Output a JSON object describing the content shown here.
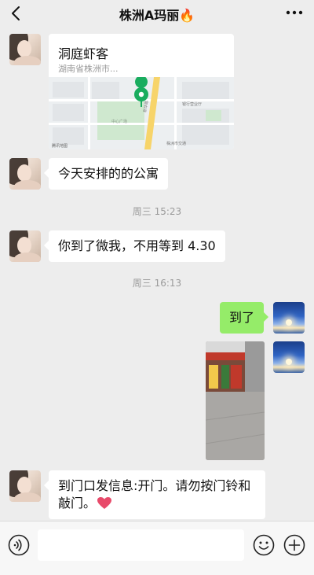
{
  "header": {
    "title": "株洲A玛丽🔥"
  },
  "messages": {
    "location": {
      "name": "洞庭虾客",
      "address": "湖南省株洲市..."
    },
    "msg1": "今天安排的的公寓",
    "time1": "周三 15:23",
    "msg2": "你到了微我，不用等到 4.30",
    "time2": "周三 16:13",
    "msg3": "到了",
    "msg4_line1": "到门口发信息:开门。请勿按门铃和",
    "msg4_line2": "敲门。"
  },
  "map": {
    "watermark": "腾讯地图",
    "label_park": "中心广场",
    "label_road": "新华路",
    "label_poi1": "株洲市交通",
    "label_poi2": "银行营业厅"
  },
  "input": {
    "placeholder": ""
  },
  "colors": {
    "background": "#ededed",
    "my_bubble": "#95ec69",
    "their_bubble": "#ffffff",
    "map_pin": "#1aad5f"
  }
}
